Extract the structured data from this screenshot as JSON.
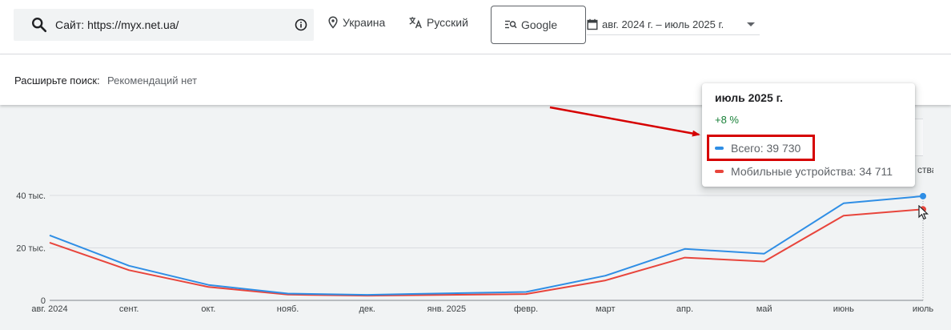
{
  "search": {
    "text": "Сайт: https://myx.net.ua/"
  },
  "filters": {
    "country": "Украина",
    "language": "Русский",
    "engine": "Google",
    "period": "авг. 2024 г. – июль 2025 г."
  },
  "expand_search": {
    "label": "Расширьте поиск:",
    "value": "Рекомендаций нет"
  },
  "colors": {
    "total": "#2f8ee5",
    "mobile": "#e8453c",
    "grid": "#dadce0",
    "annotation": "#d60000"
  },
  "tooltip": {
    "title": "июль 2025 г.",
    "change": "+8 %",
    "rows": [
      {
        "label": "Всего: 39 730"
      },
      {
        "label": "Мобильные устройства: 34 711"
      }
    ]
  },
  "background_text": "ства",
  "chart_data": {
    "type": "line",
    "categories": [
      "авг. 2024",
      "сент.",
      "окт.",
      "нояб.",
      "дек.",
      "янв. 2025",
      "февр.",
      "март",
      "апр.",
      "май",
      "июнь",
      "июль"
    ],
    "y_tick_labels": [
      "0",
      "20 тыс.",
      "40 тыс."
    ],
    "y_ticks": [
      0,
      20000,
      40000
    ],
    "ylim": [
      0,
      40000
    ],
    "grid": true,
    "series": [
      {
        "name": "Всего",
        "values": [
          24800,
          13200,
          5900,
          2600,
          2100,
          2700,
          3200,
          9400,
          19600,
          17800,
          37000,
          39730
        ]
      },
      {
        "name": "Мобильные устройства",
        "values": [
          22000,
          11500,
          5100,
          2200,
          1800,
          2100,
          2400,
          7600,
          16300,
          14800,
          32300,
          34711
        ]
      }
    ]
  }
}
